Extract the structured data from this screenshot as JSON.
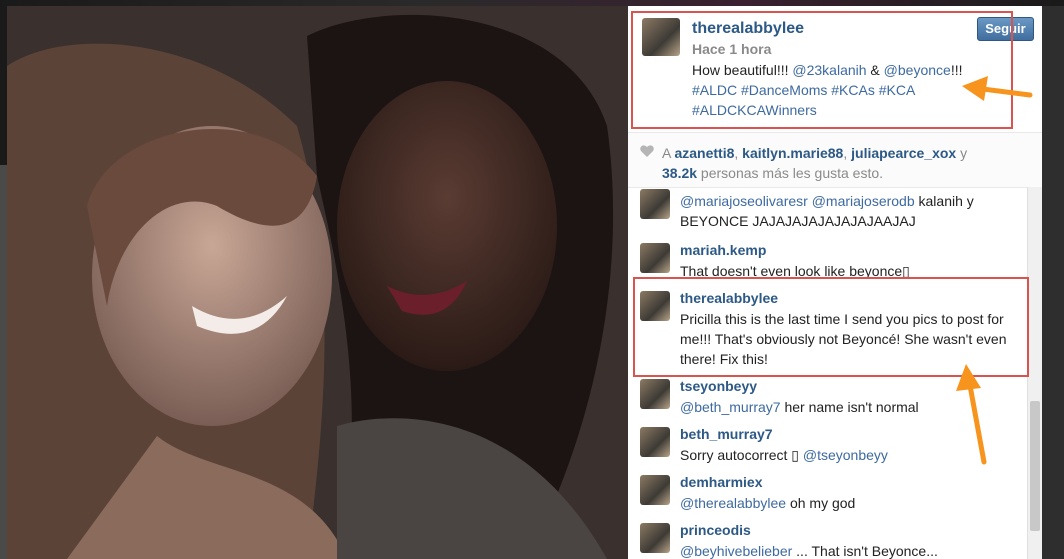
{
  "post": {
    "owner_username": "therealabbylee",
    "time_ago": "Hace 1 hora",
    "follow_button": "Seguir",
    "caption": {
      "text_1": "How beautiful!!! ",
      "mention_1": "@23kalanih",
      "text_2": " & ",
      "mention_2": "@beyonce",
      "text_3": "!!!",
      "hashtags_line1": "#ALDC #DanceMoms #KCAs #KCA",
      "hashtags_line2": "#ALDCKCAWinners"
    }
  },
  "likes": {
    "prefix": "A ",
    "user_1": "azanetti8",
    "sep_1": ", ",
    "user_2": "kaitlyn.marie88",
    "sep_2": ", ",
    "user_3": "juliapearce_xox",
    "and": " y",
    "count": "38.2k",
    "suffix": " personas más les gusta esto."
  },
  "comments": [
    {
      "username": "",
      "mention_1": "@mariajoseolivaresr",
      "mention_2": "@mariajoserodb",
      "text": " kalanih y",
      "text_line2": "BEYONCE JAJAJAJAJAJAJAJAAJAJ"
    },
    {
      "username": "mariah.kemp",
      "text": "That doesn't even look like beyonce▯"
    },
    {
      "username": "therealabbylee",
      "text": "Pricilla this is the last time I send you pics to post for me!!! That's obviously not Beyoncé! She wasn't even there! Fix this!"
    },
    {
      "username": "tseyonbeyy",
      "mention": "@beth_murray7",
      "text": " her name isn't normal"
    },
    {
      "username": "beth_murray7",
      "text": "Sorry autocorrect ▯ ",
      "mention": "@tseyonbeyy"
    },
    {
      "username": "demharmiex",
      "mention": "@therealabbylee",
      "text": " oh my god"
    },
    {
      "username": "princeodis",
      "mention": "@beyhivebelieber",
      "text": " ... That isn't Beyonce..."
    }
  ],
  "colors": {
    "link": "#2c5985",
    "highlight_box": "#d9534f",
    "arrow": "#f7941d",
    "follow_button": "#4a7aab"
  }
}
